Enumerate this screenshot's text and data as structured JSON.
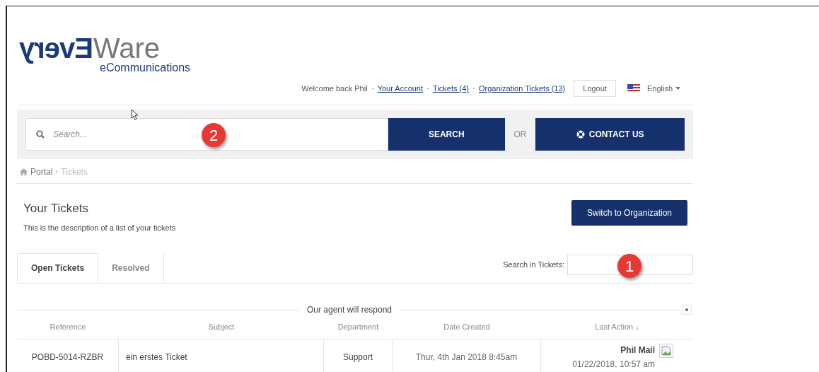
{
  "logo": {
    "mirrored": "Every",
    "rest": "Ware",
    "tagline": "eCommunications"
  },
  "top_nav": {
    "welcome": "Welcome back Phil",
    "links": [
      "Your Account",
      "Tickets (4)",
      "Organization Tickets (13)"
    ],
    "logout": "Logout",
    "language": "English"
  },
  "search_bar": {
    "placeholder": "Search...",
    "search_button": "SEARCH",
    "or": "OR",
    "contact_button": "CONTACT US",
    "marker": "2"
  },
  "breadcrumb": [
    "Portal",
    "Tickets"
  ],
  "page": {
    "title": "Your Tickets",
    "description": "This is the description of a list of your tickets",
    "switch_button": "Switch to Organization"
  },
  "tabs": [
    {
      "label": "Open Tickets",
      "selected": true
    },
    {
      "label": "Resolved",
      "selected": false
    }
  ],
  "ticket_search": {
    "label": "Search in Tickets:",
    "marker": "1"
  },
  "table": {
    "group_label": "Our agent will respond",
    "columns": [
      "Reference",
      "Subject",
      "Department",
      "Date Created",
      "Last Action ↓"
    ],
    "rows": [
      {
        "reference": "POBD-5014-RZBR",
        "subject": "ein erstes Ticket",
        "department": "Support",
        "date_created": "Thur, 4th Jan 2018 8:45am",
        "last_action_by": "Phil Mail",
        "last_action_time": "01/22/2018, 10:57 am"
      }
    ]
  }
}
